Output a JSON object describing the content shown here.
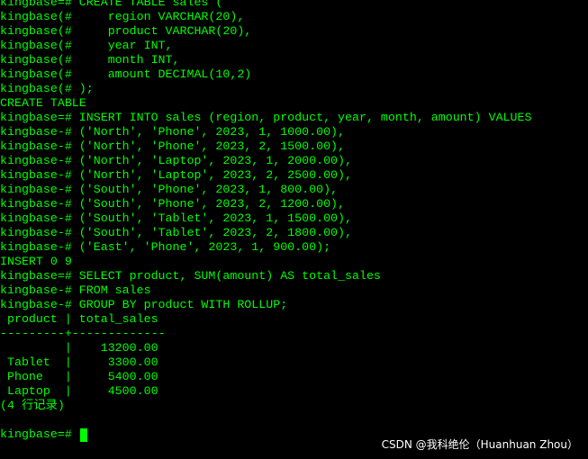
{
  "terminal": {
    "lines": [
      "kingbase=# CREATE TABLE sales (",
      "kingbase(#     region VARCHAR(20),",
      "kingbase(#     product VARCHAR(20),",
      "kingbase(#     year INT,",
      "kingbase(#     month INT,",
      "kingbase(#     amount DECIMAL(10,2)",
      "kingbase(# );",
      "CREATE TABLE",
      "kingbase=# INSERT INTO sales (region, product, year, month, amount) VALUES",
      "kingbase-# ('North', 'Phone', 2023, 1, 1000.00),",
      "kingbase-# ('North', 'Phone', 2023, 2, 1500.00),",
      "kingbase-# ('North', 'Laptop', 2023, 1, 2000.00),",
      "kingbase-# ('North', 'Laptop', 2023, 2, 2500.00),",
      "kingbase-# ('South', 'Phone', 2023, 1, 800.00),",
      "kingbase-# ('South', 'Phone', 2023, 2, 1200.00),",
      "kingbase-# ('South', 'Tablet', 2023, 1, 1500.00),",
      "kingbase-# ('South', 'Tablet', 2023, 2, 1800.00),",
      "kingbase-# ('East', 'Phone', 2023, 1, 900.00);",
      "INSERT 0 9",
      "kingbase=# SELECT product, SUM(amount) AS total_sales",
      "kingbase-# FROM sales",
      "kingbase-# GROUP BY product WITH ROLLUP;",
      " product | total_sales",
      "---------+-------------",
      "         |    13200.00",
      " Tablet  |     3300.00",
      " Phone   |     5400.00",
      " Laptop  |     4500.00",
      "(4 行记录)"
    ],
    "prompt": "kingbase=# "
  },
  "watermark": "CSDN @我科绝伦（Huanhuan Zhou）",
  "colors": {
    "background": "#000000",
    "text": "#00ff00",
    "watermark": "#ffffff"
  }
}
